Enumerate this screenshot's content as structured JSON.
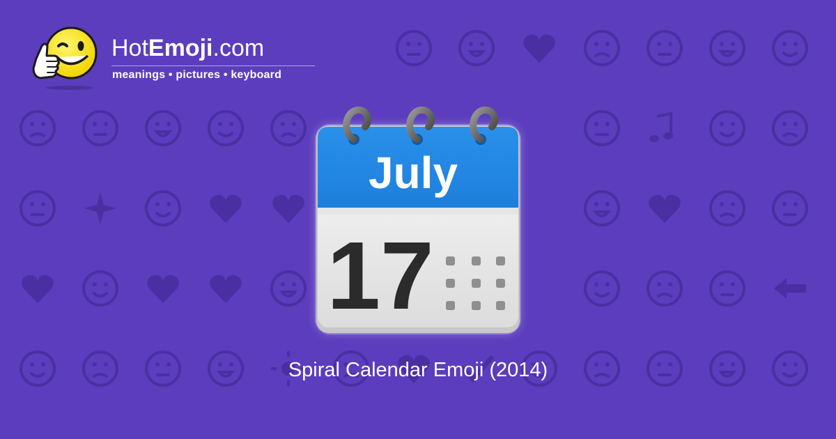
{
  "site": {
    "name_regular": "Hot",
    "name_bold": "Emoji",
    "name_suffix": ".com",
    "tagline": "meanings • pictures • keyboard",
    "mascot": "winking-thumbs-up-smiley-icon"
  },
  "emoji": {
    "month": "July",
    "day": "17",
    "icon": "spiral-calendar-icon"
  },
  "caption": "Spiral Calendar Emoji (2014)",
  "colors": {
    "background": "#5b3dbd",
    "pattern": "#4a2fa3",
    "calendar_header": "#1e88e5",
    "calendar_body": "#f1f1f1",
    "day_text": "#2b2b2b",
    "text": "#ffffff"
  },
  "background_icons": [
    "smile-icon",
    "kiss-wink-icon",
    "two-hearts-icon",
    "smile-icon",
    "weary-icon",
    "ok-hand-icon",
    "neutral-face-icon",
    "eyes-icon",
    "smirk-icon",
    "relieved-icon",
    "sweat-face-icon",
    "recycle-icon",
    "raising-hands-icon",
    "music-notes-icon",
    "sleepy-icon",
    "sad-face-icon",
    "grin-icon",
    "sparkles-icon",
    "grin-icon",
    "striped-heart-icon",
    "broken-heart-icon",
    "confused-face-icon",
    "striped-heart-icon",
    "tongue-wink-icon",
    "frown-icon",
    "heart-arrow-icon",
    "tired-face-icon",
    "revolving-hearts-icon",
    "heart-icon",
    "monkey-icon",
    "scream-icon",
    "smiling-imp-icon",
    "angry-face-icon",
    "left-arrow-icon",
    "fire-icon",
    "party-popper-icon",
    "tongue-face-icon",
    "rose-icon",
    "sun-icon",
    "flexed-biceps-icon",
    "striped-heart-icon",
    "check-mark-icon",
    "laughing-icon",
    "moon-face-icon",
    "cat-face-icon",
    "wave-hand-icon",
    "mask-face-icon",
    "camera-icon",
    "frown-icon",
    "hands-icon",
    "grin-icon",
    "heart-icon",
    "relieved-icon",
    "kiss-face-icon"
  ]
}
